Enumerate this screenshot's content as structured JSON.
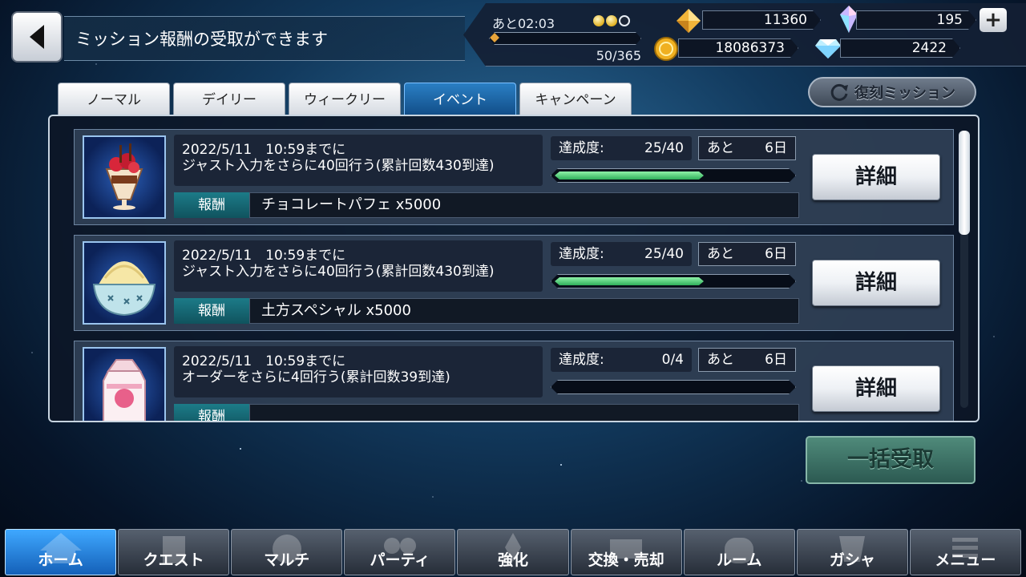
{
  "header": {
    "title": "ミッション報酬の受取ができます",
    "stamina_time": "あと02:03",
    "stamina_count": "50/365",
    "stamina_orbs": {
      "full": 2,
      "empty": 1
    },
    "stamina_fill": 0,
    "currencies": {
      "gold_prism": "11360",
      "rainbow_crystal": "195",
      "coins": "18086373",
      "diamond": "2422"
    },
    "plus_label": "+"
  },
  "tabs": [
    {
      "label": "ノーマル",
      "active": false
    },
    {
      "label": "デイリー",
      "active": false
    },
    {
      "label": "ウィークリー",
      "active": false
    },
    {
      "label": "イベント",
      "active": true
    },
    {
      "label": "キャンペーン",
      "active": false
    }
  ],
  "reprint_button": "復刻ミッション",
  "missions": [
    {
      "line1": "2022/5/11　10:59までに",
      "line2": "ジャスト入力をさらに40回行う(累計回数430到達)",
      "progress_label": "達成度:",
      "progress": "25/40",
      "progress_ratio": 0.625,
      "remain_label": "あと",
      "remain": "6日",
      "reward_label": "報酬",
      "reward": "チョコレートパフェ x5000",
      "detail": "詳細",
      "item": "chocolate-parfait"
    },
    {
      "line1": "2022/5/11　10:59までに",
      "line2": "ジャスト入力をさらに40回行う(累計回数430到達)",
      "progress_label": "達成度:",
      "progress": "25/40",
      "progress_ratio": 0.625,
      "remain_label": "あと",
      "remain": "6日",
      "reward_label": "報酬",
      "reward": "土方スペシャル x5000",
      "detail": "詳細",
      "item": "hijikata-special"
    },
    {
      "line1": "2022/5/11　10:59までに",
      "line2": "オーダーをさらに4回行う(累計回数39到達)",
      "progress_label": "達成度:",
      "progress": "0/4",
      "progress_ratio": 0,
      "remain_label": "あと",
      "remain": "6日",
      "reward_label": "報酬",
      "reward": "",
      "detail": "詳細",
      "item": "strawberry-milk"
    }
  ],
  "bulk_receive": "一括受取",
  "nav": [
    {
      "label": "ホーム",
      "active": true,
      "icon": "home-icon"
    },
    {
      "label": "クエスト",
      "active": false,
      "icon": "quest-icon"
    },
    {
      "label": "マルチ",
      "active": false,
      "icon": "multi-icon"
    },
    {
      "label": "パーティ",
      "active": false,
      "icon": "party-icon"
    },
    {
      "label": "強化",
      "active": false,
      "icon": "enhance-icon"
    },
    {
      "label": "交換・売却",
      "active": false,
      "icon": "exchange-icon"
    },
    {
      "label": "ルーム",
      "active": false,
      "icon": "room-icon"
    },
    {
      "label": "ガシャ",
      "active": false,
      "icon": "gacha-icon"
    },
    {
      "label": "メニュー",
      "active": false,
      "icon": "menu-icon"
    }
  ],
  "colors": {
    "active_tab": "#1d6bb0",
    "progress_fill": "#3fd070",
    "reward_label_bg": "#167080",
    "nav_active": "#2f8ff0"
  }
}
